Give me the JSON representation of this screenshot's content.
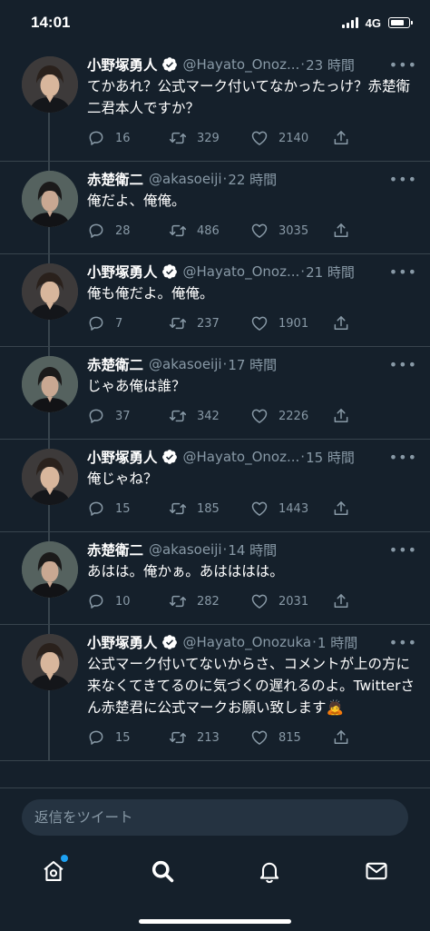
{
  "status_bar": {
    "time": "14:01",
    "network": "4G"
  },
  "thread": [
    {
      "name": "小野塚勇人",
      "verified": true,
      "handle": "@Hayato_Onoz...",
      "time": "23 時間",
      "text": "てかあれ？公式マーク付いてなかったっけ？赤楚衛二君本人ですか？",
      "replies": "16",
      "retweets": "329",
      "likes": "2140",
      "avatar": "hayato-avatar"
    },
    {
      "name": "赤楚衛二",
      "verified": false,
      "handle": "@akasoeiji",
      "time": "22 時間",
      "text": "俺だよ、俺俺。",
      "replies": "28",
      "retweets": "486",
      "likes": "3035",
      "avatar": "eiji-avatar"
    },
    {
      "name": "小野塚勇人",
      "verified": true,
      "handle": "@Hayato_Onoz...",
      "time": "21 時間",
      "text": "俺も俺だよ。俺俺。",
      "replies": "7",
      "retweets": "237",
      "likes": "1901",
      "avatar": "hayato-avatar"
    },
    {
      "name": "赤楚衛二",
      "verified": false,
      "handle": "@akasoeiji",
      "time": "17 時間",
      "text": "じゃあ俺は誰？",
      "replies": "37",
      "retweets": "342",
      "likes": "2226",
      "avatar": "eiji-avatar"
    },
    {
      "name": "小野塚勇人",
      "verified": true,
      "handle": "@Hayato_Onoz...",
      "time": "15 時間",
      "text": "俺じゃね？",
      "replies": "15",
      "retweets": "185",
      "likes": "1443",
      "avatar": "hayato-avatar"
    },
    {
      "name": "赤楚衛二",
      "verified": false,
      "handle": "@akasoeiji",
      "time": "14 時間",
      "text": "あはは。俺かぁ。あはははは。",
      "replies": "10",
      "retweets": "282",
      "likes": "2031",
      "avatar": "eiji-avatar"
    },
    {
      "name": "小野塚勇人",
      "verified": true,
      "handle": "@Hayato_Onozuka",
      "time": "1 時間",
      "text": "公式マーク付いてないからさ、コメントが上の方に来なくてきてるのに気づくの遅れるのよ。Twitterさん赤楚君に公式マークお願い致します🙇",
      "replies": "15",
      "retweets": "213",
      "likes": "815",
      "avatar": "hayato-avatar"
    }
  ],
  "reply": {
    "placeholder": "返信をツイート"
  },
  "tab_bar": {
    "items": [
      "home-icon",
      "search-icon",
      "notifications-icon",
      "messages-icon"
    ],
    "home_has_badge": true
  },
  "colors": {
    "background": "#15202b",
    "accent": "#1da1f2",
    "secondary_text": "#8899a6",
    "divider": "#38444d"
  }
}
